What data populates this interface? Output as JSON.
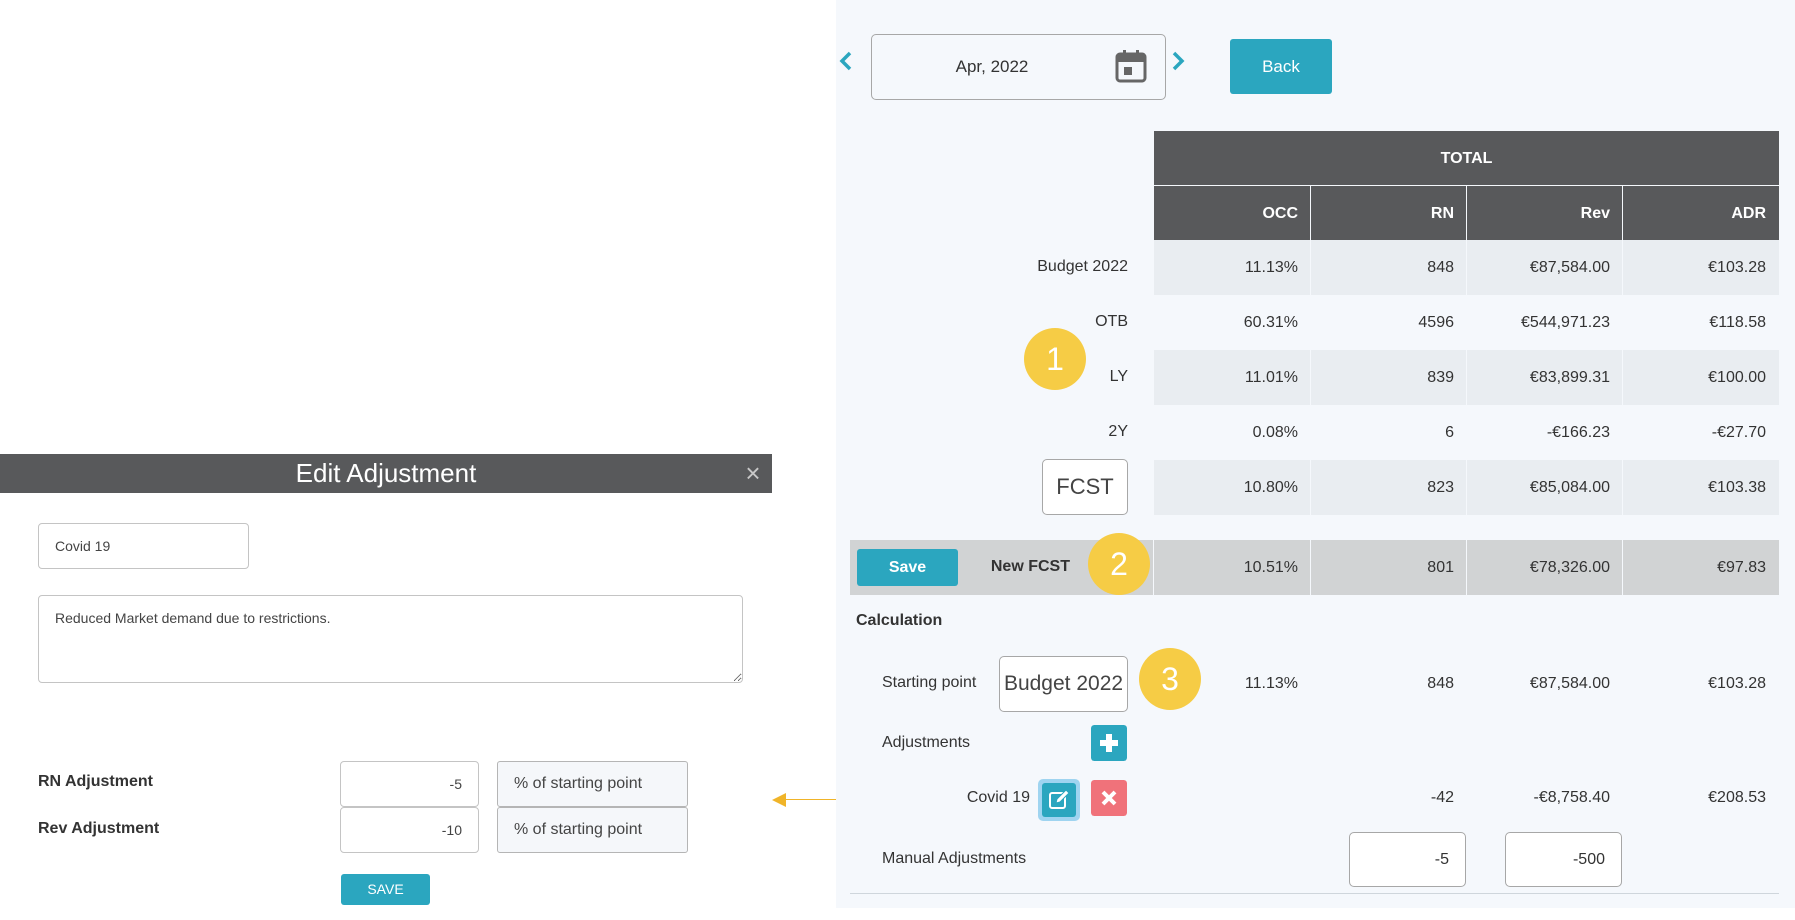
{
  "modal": {
    "title": "Edit Adjustment",
    "close_glyph": "×",
    "name_value": "Covid 19",
    "description_value": "Reduced Market demand due to restrictions.",
    "rn_label": "RN Adjustment",
    "rn_value": "-5",
    "rn_mode": "% of starting point",
    "rev_label": "Rev Adjustment",
    "rev_value": "-10",
    "rev_mode": "% of starting point",
    "save_label": "SAVE"
  },
  "header": {
    "date_value": "Apr, 2022",
    "back_label": "Back",
    "icons": [
      "chevron-left-icon",
      "calendar-icon",
      "chevron-right-icon"
    ]
  },
  "table": {
    "group_title": "TOTAL",
    "columns": [
      "OCC",
      "RN",
      "Rev",
      "ADR"
    ],
    "rows": [
      {
        "label": "Budget 2022",
        "values": [
          "11.13%",
          "848",
          "€87,584.00",
          "€103.28"
        ]
      },
      {
        "label": "OTB",
        "values": [
          "60.31%",
          "4596",
          "€544,971.23",
          "€118.58"
        ]
      },
      {
        "label": "LY",
        "values": [
          "11.01%",
          "839",
          "€83,899.31",
          "€100.00"
        ]
      },
      {
        "label": "2Y",
        "values": [
          "0.08%",
          "6",
          "-€166.23",
          "-€27.70"
        ]
      },
      {
        "label": "FCST",
        "values": [
          "10.80%",
          "823",
          "€85,084.00",
          "€103.38"
        ]
      }
    ],
    "new_fcst": {
      "save_label": "Save",
      "label": "New FCST",
      "values": [
        "10.51%",
        "801",
        "€78,326.00",
        "€97.83"
      ]
    }
  },
  "calculation": {
    "title": "Calculation",
    "starting_point_label": "Starting point",
    "starting_point_value": "Budget 2022",
    "starting_values": [
      "11.13%",
      "848",
      "€87,584.00",
      "€103.28"
    ],
    "adjustments_label": "Adjustments",
    "adjustment": {
      "name": "Covid 19",
      "values": [
        "",
        "-42",
        "-€8,758.40",
        "€208.53"
      ]
    },
    "manual_label": "Manual Adjustments",
    "manual_rn": "-5",
    "manual_rev": "-500"
  },
  "badges": [
    "1",
    "2",
    "3"
  ],
  "colors": {
    "accent": "#2ba6bf",
    "header_dark": "#58595b",
    "badge_yellow": "#f6cc45",
    "delete_red": "#f0727a",
    "pointer_arrow": "#f0b429"
  }
}
